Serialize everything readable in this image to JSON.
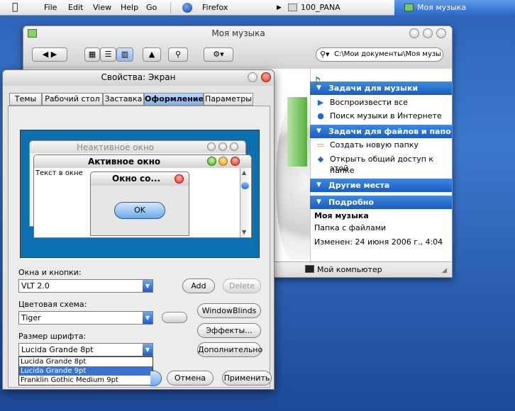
{
  "menubar": {
    "apple_icon": "apple-icon",
    "items": [
      "File",
      "Edit",
      "View",
      "Help",
      "Go"
    ],
    "browser": "Firefox",
    "folder": "100_PANA",
    "active_window": "Моя музыка"
  },
  "finder": {
    "title": "Моя музыка",
    "search_path": "C:\\Мои документы\\Моя музы",
    "music_tasks": {
      "title": "Задачи для музыки",
      "items": [
        "Воспроизвести все",
        "Поиск музыки в Интернете"
      ]
    },
    "file_tasks": {
      "title": "Задачи для файлов и папо",
      "items": [
        "Создать новую папку",
        "Открыть общий доступ к этой",
        "папке"
      ]
    },
    "other_places": {
      "title": "Другие места"
    },
    "details": {
      "title": "Подробно",
      "name": "Моя музыка",
      "type": "Папка с файлами",
      "modified": "Изменен: 24 июня 2006 г., 4:04"
    },
    "status": "Мой компьютер"
  },
  "dialog": {
    "title": "Свойства: Экран",
    "tabs": [
      "Темы",
      "Рабочий стол",
      "Заставка",
      "Оформление",
      "Параметры"
    ],
    "selected_tab": "Оформление",
    "preview": {
      "inactive_title": "Неактивное окно",
      "active_title": "Активное окно",
      "window_text": "Текст в окне",
      "msgbox_title": "Окно со...",
      "ok_label": "OK"
    },
    "windows_buttons_label": "Окна и кнопки:",
    "windows_buttons_value": "VLT 2.0",
    "add_label": "Add",
    "delete_label": "Delete",
    "color_scheme_label": "Цветовая схема:",
    "color_scheme_value": "Tiger",
    "windowblinds_label": "WindowBlinds",
    "effects_label": "Эффекты...",
    "font_size_label": "Размер шрифта:",
    "font_size_value": "Lucida Grande 8pt",
    "advanced_label": "Дополнительно",
    "font_options": [
      "Lucida Grande 8pt",
      "Lucida Grande 9pt",
      "Franklin Gothic Medium 9pt"
    ],
    "highlighted_option": "Lucida Grande 9pt",
    "cancel_label": "Отмена",
    "apply_label": "Применить"
  }
}
